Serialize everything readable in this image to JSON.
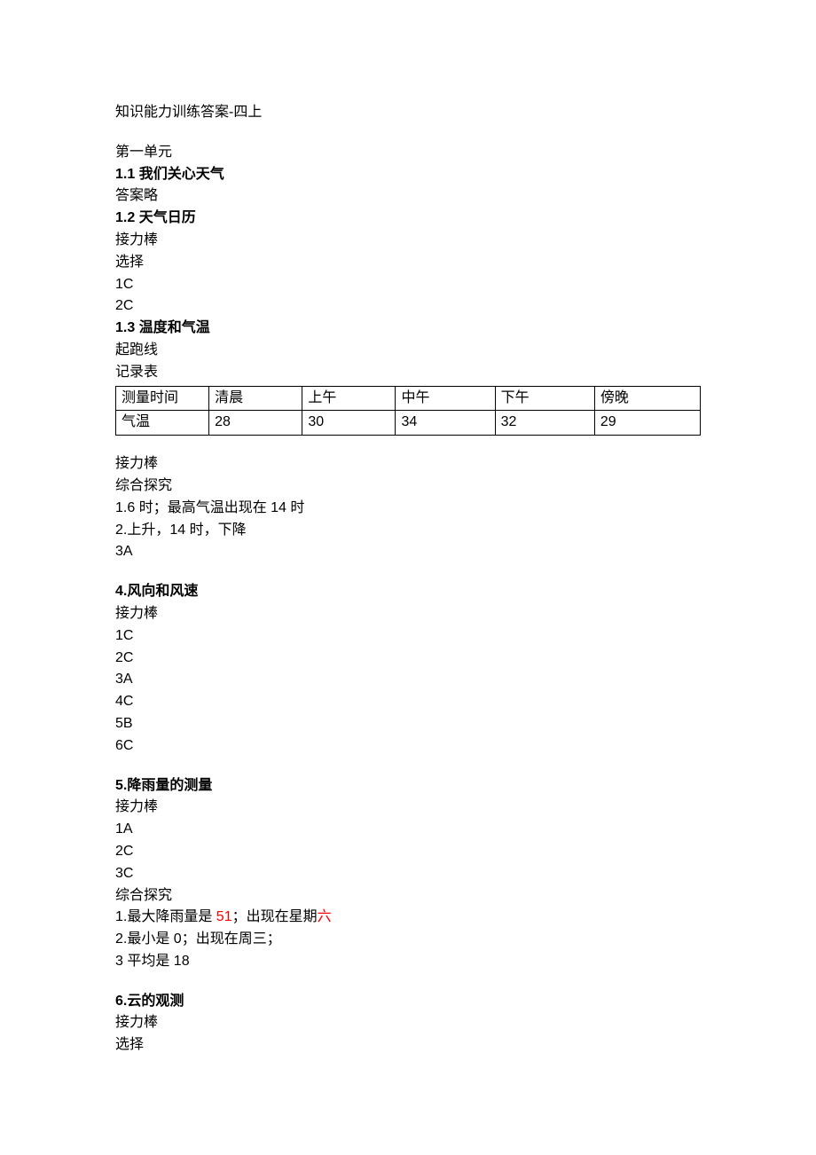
{
  "title": "知识能力训练答案-四上",
  "unit": "第一单元",
  "s1_1": {
    "heading": "1.1 我们关心天气",
    "line1": "答案略"
  },
  "s1_2": {
    "heading": "1.2 天气日历",
    "line1": "接力棒",
    "line2": "选择",
    "line3": "1C",
    "line4": "2C"
  },
  "s1_3": {
    "heading": "1.3 温度和气温",
    "line1": "起跑线",
    "line2": "记录表",
    "table": {
      "header": [
        "测量时间",
        "清晨",
        "上午",
        "中午",
        "下午",
        "傍晚"
      ],
      "row": [
        "气温",
        "28",
        "30",
        "34",
        "32",
        "29"
      ]
    },
    "after": {
      "l1": "接力棒",
      "l2": "综合探究",
      "l3": "1.6 时；最高气温出现在 14 时",
      "l4": "2.上升，14 时，下降",
      "l5": "3A"
    }
  },
  "s4": {
    "heading": "4.风向和风速",
    "l1": "接力棒",
    "l2": "1C",
    "l3": "2C",
    "l4": "3A",
    "l5": "4C",
    "l6": "5B",
    "l7": "6C"
  },
  "s5": {
    "heading": "5.降雨量的测量",
    "l1": "接力棒",
    "l2": "1A",
    "l3": "2C",
    "l4": "3C",
    "l5": "综合探究",
    "l6_pre": "1.最大降雨量是 ",
    "l6_red": "51",
    "l6_mid": "；出现在星期",
    "l6_red2": "六",
    "l7": "2.最小是 0；出现在周三；",
    "l8": "3 平均是 18"
  },
  "s6": {
    "heading": "6.云的观测",
    "l1": "接力棒",
    "l2": "选择"
  }
}
